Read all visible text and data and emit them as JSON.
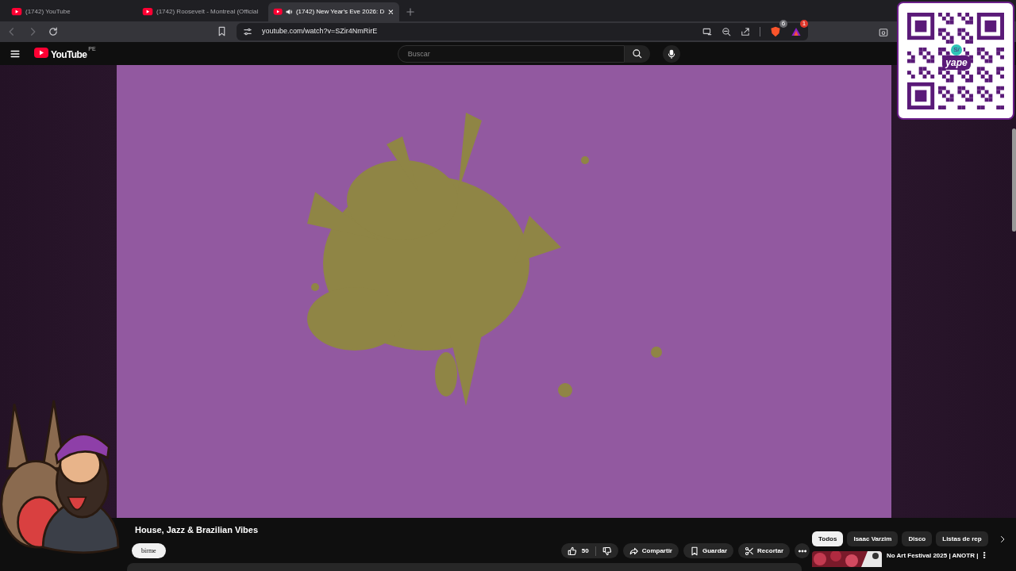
{
  "browser": {
    "tabs": [
      {
        "title": "(1742) YouTube",
        "selected": false,
        "audio": false
      },
      {
        "title": "(1742) Roosevelt - Montreal (Official",
        "selected": false,
        "audio": false
      },
      {
        "title": "(1742) New Year's Eve 2026: D",
        "selected": true,
        "audio": true
      }
    ],
    "address": "youtube.com/watch?v=SZir4NmRirE",
    "extensions": [
      {
        "kind": "shield",
        "badge": "6"
      },
      {
        "kind": "triangle",
        "badge": "1"
      }
    ]
  },
  "youtube": {
    "logo": "YouTube",
    "region": "PE",
    "search": {
      "placeholder": "Buscar"
    }
  },
  "video": {
    "kind": "picture",
    "title": "House, Jazz & Brazilian Vibes",
    "subscribe": "birme",
    "likes": "50",
    "actions": [
      {
        "kind": "share",
        "label": "Compartir"
      },
      {
        "kind": "save",
        "label": "Guardar"
      },
      {
        "kind": "clip",
        "label": "Recortar"
      }
    ]
  },
  "chips": [
    {
      "label": "Todos",
      "selected": true
    },
    {
      "label": "Isaac Varzim",
      "selected": false
    },
    {
      "label": "Disco",
      "selected": false
    },
    {
      "label": "Listas de rep",
      "selected": false
    }
  ],
  "recommended": [
    {
      "title": "No Art Festival 2025 | ANOTR |"
    }
  ],
  "overlay": {
    "qr_currency": "S/",
    "qr_brand": "yape"
  }
}
